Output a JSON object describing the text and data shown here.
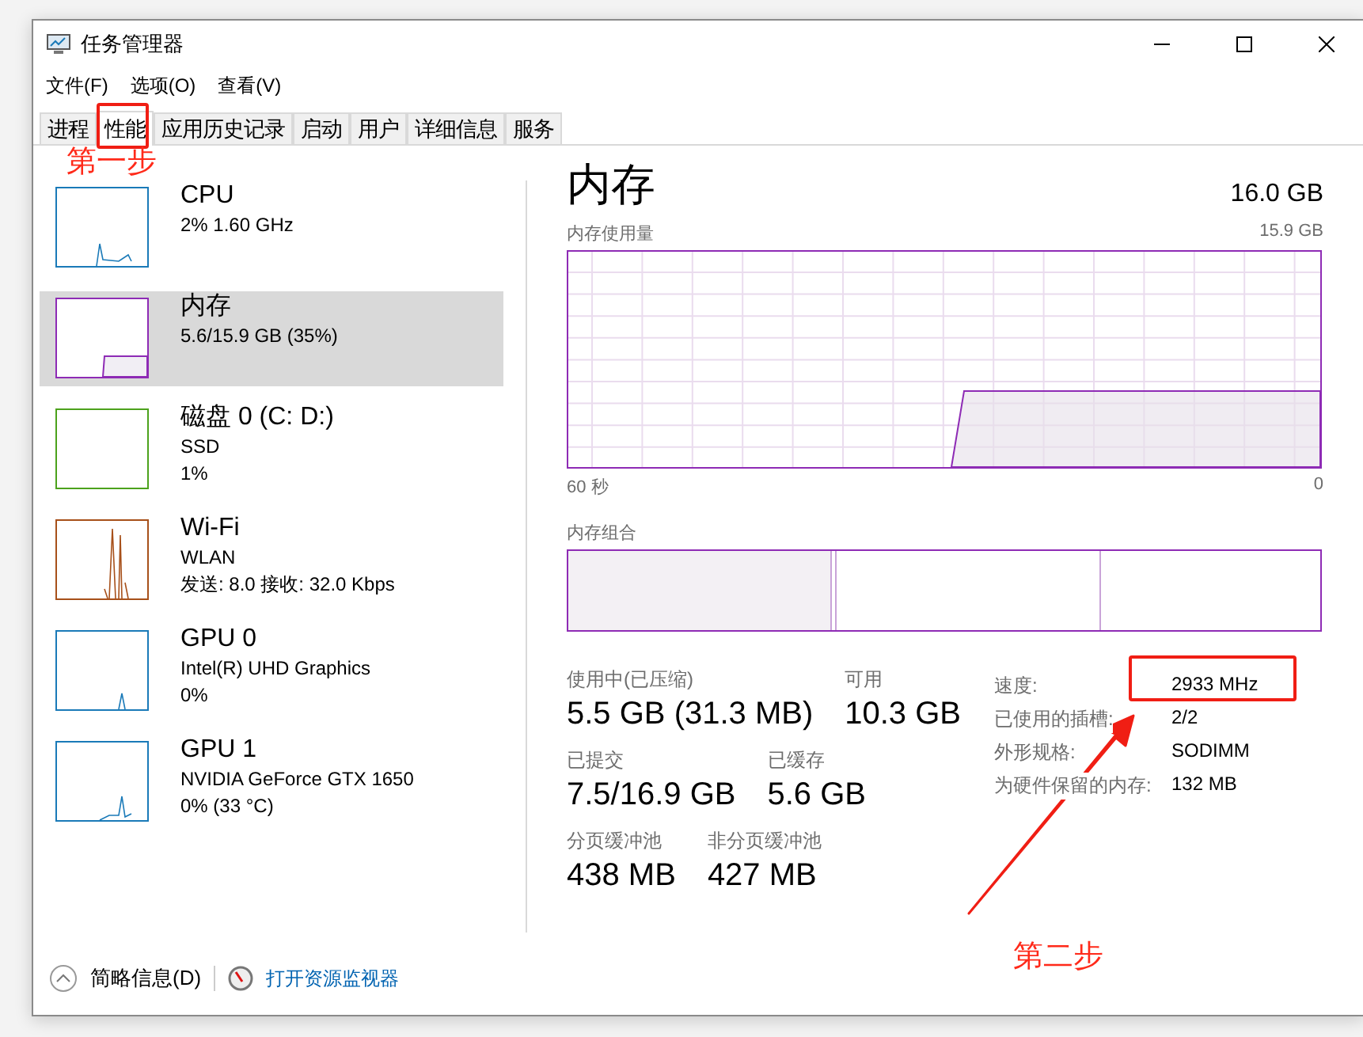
{
  "window": {
    "title": "任务管理器"
  },
  "menu": [
    "文件(F)",
    "选项(O)",
    "查看(V)"
  ],
  "tabs": [
    {
      "label": "进程",
      "selected": false
    },
    {
      "label": "性能",
      "selected": true
    },
    {
      "label": "应用历史记录",
      "selected": false
    },
    {
      "label": "启动",
      "selected": false
    },
    {
      "label": "用户",
      "selected": false
    },
    {
      "label": "详细信息",
      "selected": false
    },
    {
      "label": "服务",
      "selected": false
    }
  ],
  "sidebar": {
    "items": [
      {
        "name": "CPU",
        "line_2": "2% 1.60 GHz",
        "color": "#1a7ab8",
        "selected": false
      },
      {
        "name": "内存",
        "line_2": "5.6/15.9 GB (35%)",
        "color": "#8e2bb5",
        "selected": true
      },
      {
        "name": "磁盘 0 (C: D:)",
        "line_2": "SSD",
        "line_3": "1%",
        "color": "#4ca21c",
        "selected": false
      },
      {
        "name": "Wi-Fi",
        "line_2": "WLAN",
        "line_3": "发送: 8.0 接收: 32.0 Kbps",
        "color": "#a7501a",
        "selected": false
      },
      {
        "name": "GPU 0",
        "line_2": "Intel(R) UHD Graphics",
        "line_3": "0%",
        "color": "#1a7ab8",
        "selected": false
      },
      {
        "name": "GPU 1",
        "line_2": "NVIDIA GeForce GTX 1650",
        "line_3": "0% (33 °C)",
        "color": "#1a7ab8",
        "selected": false
      }
    ]
  },
  "detail": {
    "title": "内存",
    "capacity": "16.0 GB",
    "usage_label": "内存使用量",
    "usage_max": "15.9 GB",
    "time_start": "60 秒",
    "time_end": "0",
    "composition_label": "内存组合",
    "stats": [
      [
        {
          "label": "使用中(已压缩)",
          "value": "5.5 GB (31.3 MB)"
        },
        {
          "label": "可用",
          "value": "10.3 GB"
        }
      ],
      [
        {
          "label": "已提交",
          "value": "7.5/16.9 GB"
        },
        {
          "label": "已缓存",
          "value": "5.6 GB"
        }
      ],
      [
        {
          "label": "分页缓冲池",
          "value": "438 MB"
        },
        {
          "label": "非分页缓冲池",
          "value": "427 MB"
        }
      ]
    ],
    "specs": [
      {
        "label": "速度:",
        "value": "2933 MHz"
      },
      {
        "label": "已使用的插槽:",
        "value": "2/2"
      },
      {
        "label": "外形规格:",
        "value": "SODIMM"
      },
      {
        "label": "为硬件保留的内存:",
        "value": "132 MB"
      }
    ]
  },
  "footer": {
    "fewer_details": "简略信息(D)",
    "open_monitor": "打开资源监视器"
  },
  "annotations": [
    "第一步",
    "第二步"
  ]
}
